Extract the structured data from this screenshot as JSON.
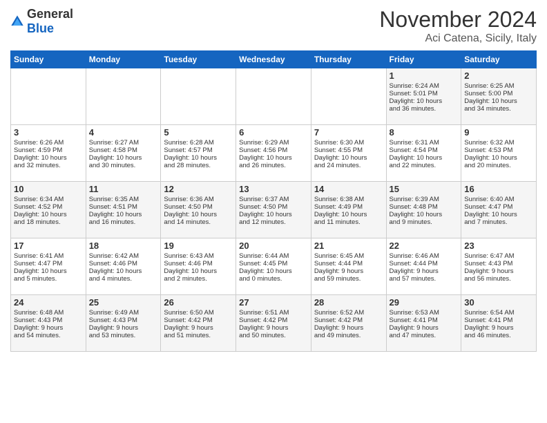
{
  "header": {
    "logo_general": "General",
    "logo_blue": "Blue",
    "title": "November 2024",
    "subtitle": "Aci Catena, Sicily, Italy"
  },
  "days_of_week": [
    "Sunday",
    "Monday",
    "Tuesday",
    "Wednesday",
    "Thursday",
    "Friday",
    "Saturday"
  ],
  "weeks": [
    [
      {
        "day": "",
        "content": ""
      },
      {
        "day": "",
        "content": ""
      },
      {
        "day": "",
        "content": ""
      },
      {
        "day": "",
        "content": ""
      },
      {
        "day": "",
        "content": ""
      },
      {
        "day": "1",
        "content": "Sunrise: 6:24 AM\nSunset: 5:01 PM\nDaylight: 10 hours\nand 36 minutes."
      },
      {
        "day": "2",
        "content": "Sunrise: 6:25 AM\nSunset: 5:00 PM\nDaylight: 10 hours\nand 34 minutes."
      }
    ],
    [
      {
        "day": "3",
        "content": "Sunrise: 6:26 AM\nSunset: 4:59 PM\nDaylight: 10 hours\nand 32 minutes."
      },
      {
        "day": "4",
        "content": "Sunrise: 6:27 AM\nSunset: 4:58 PM\nDaylight: 10 hours\nand 30 minutes."
      },
      {
        "day": "5",
        "content": "Sunrise: 6:28 AM\nSunset: 4:57 PM\nDaylight: 10 hours\nand 28 minutes."
      },
      {
        "day": "6",
        "content": "Sunrise: 6:29 AM\nSunset: 4:56 PM\nDaylight: 10 hours\nand 26 minutes."
      },
      {
        "day": "7",
        "content": "Sunrise: 6:30 AM\nSunset: 4:55 PM\nDaylight: 10 hours\nand 24 minutes."
      },
      {
        "day": "8",
        "content": "Sunrise: 6:31 AM\nSunset: 4:54 PM\nDaylight: 10 hours\nand 22 minutes."
      },
      {
        "day": "9",
        "content": "Sunrise: 6:32 AM\nSunset: 4:53 PM\nDaylight: 10 hours\nand 20 minutes."
      }
    ],
    [
      {
        "day": "10",
        "content": "Sunrise: 6:34 AM\nSunset: 4:52 PM\nDaylight: 10 hours\nand 18 minutes."
      },
      {
        "day": "11",
        "content": "Sunrise: 6:35 AM\nSunset: 4:51 PM\nDaylight: 10 hours\nand 16 minutes."
      },
      {
        "day": "12",
        "content": "Sunrise: 6:36 AM\nSunset: 4:50 PM\nDaylight: 10 hours\nand 14 minutes."
      },
      {
        "day": "13",
        "content": "Sunrise: 6:37 AM\nSunset: 4:50 PM\nDaylight: 10 hours\nand 12 minutes."
      },
      {
        "day": "14",
        "content": "Sunrise: 6:38 AM\nSunset: 4:49 PM\nDaylight: 10 hours\nand 11 minutes."
      },
      {
        "day": "15",
        "content": "Sunrise: 6:39 AM\nSunset: 4:48 PM\nDaylight: 10 hours\nand 9 minutes."
      },
      {
        "day": "16",
        "content": "Sunrise: 6:40 AM\nSunset: 4:47 PM\nDaylight: 10 hours\nand 7 minutes."
      }
    ],
    [
      {
        "day": "17",
        "content": "Sunrise: 6:41 AM\nSunset: 4:47 PM\nDaylight: 10 hours\nand 5 minutes."
      },
      {
        "day": "18",
        "content": "Sunrise: 6:42 AM\nSunset: 4:46 PM\nDaylight: 10 hours\nand 4 minutes."
      },
      {
        "day": "19",
        "content": "Sunrise: 6:43 AM\nSunset: 4:46 PM\nDaylight: 10 hours\nand 2 minutes."
      },
      {
        "day": "20",
        "content": "Sunrise: 6:44 AM\nSunset: 4:45 PM\nDaylight: 10 hours\nand 0 minutes."
      },
      {
        "day": "21",
        "content": "Sunrise: 6:45 AM\nSunset: 4:44 PM\nDaylight: 9 hours\nand 59 minutes."
      },
      {
        "day": "22",
        "content": "Sunrise: 6:46 AM\nSunset: 4:44 PM\nDaylight: 9 hours\nand 57 minutes."
      },
      {
        "day": "23",
        "content": "Sunrise: 6:47 AM\nSunset: 4:43 PM\nDaylight: 9 hours\nand 56 minutes."
      }
    ],
    [
      {
        "day": "24",
        "content": "Sunrise: 6:48 AM\nSunset: 4:43 PM\nDaylight: 9 hours\nand 54 minutes."
      },
      {
        "day": "25",
        "content": "Sunrise: 6:49 AM\nSunset: 4:43 PM\nDaylight: 9 hours\nand 53 minutes."
      },
      {
        "day": "26",
        "content": "Sunrise: 6:50 AM\nSunset: 4:42 PM\nDaylight: 9 hours\nand 51 minutes."
      },
      {
        "day": "27",
        "content": "Sunrise: 6:51 AM\nSunset: 4:42 PM\nDaylight: 9 hours\nand 50 minutes."
      },
      {
        "day": "28",
        "content": "Sunrise: 6:52 AM\nSunset: 4:42 PM\nDaylight: 9 hours\nand 49 minutes."
      },
      {
        "day": "29",
        "content": "Sunrise: 6:53 AM\nSunset: 4:41 PM\nDaylight: 9 hours\nand 47 minutes."
      },
      {
        "day": "30",
        "content": "Sunrise: 6:54 AM\nSunset: 4:41 PM\nDaylight: 9 hours\nand 46 minutes."
      }
    ]
  ]
}
